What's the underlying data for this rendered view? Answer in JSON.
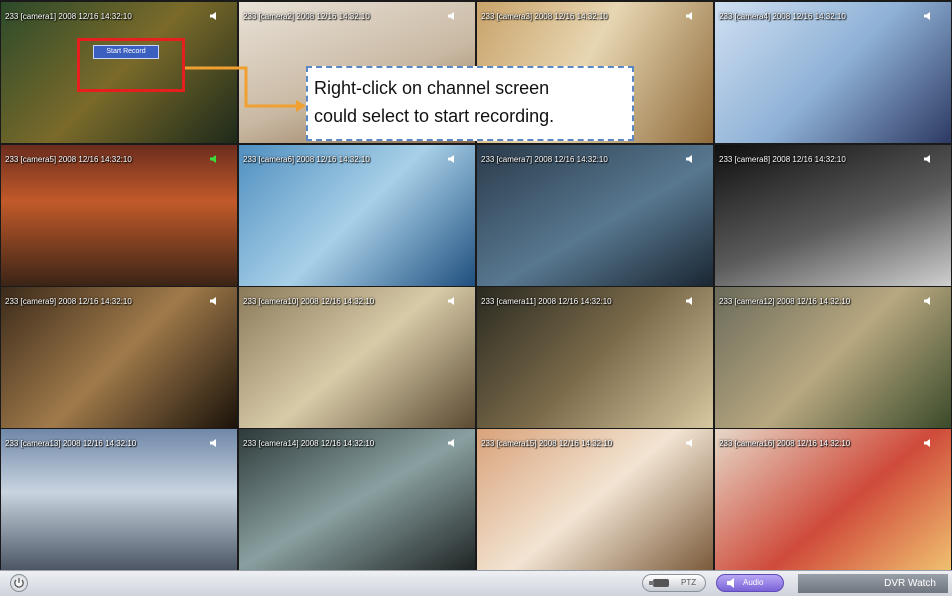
{
  "channels": [
    {
      "label": "233 [camera1] 2008 12/16 14:32:10"
    },
    {
      "label": "233 [camera2] 2008 12/16 14:32:10"
    },
    {
      "label": "233 [camera3] 2008 12/16 14:32:10"
    },
    {
      "label": "233 [camera4] 2008 12/16 14:32:10"
    },
    {
      "label": "233 [camera5] 2008 12/16 14:32:10"
    },
    {
      "label": "233 [camera6] 2008 12/16 14:32:10"
    },
    {
      "label": "233 [camera7] 2008 12/16 14:32:10"
    },
    {
      "label": "233 [camera8] 2008 12/16 14:32:10"
    },
    {
      "label": "233 [camera9] 2008 12/16 14:32:10"
    },
    {
      "label": "233 [camera10] 2008 12/16 14:32:10"
    },
    {
      "label": "233 [camera11] 2008 12/16 14:32:10"
    },
    {
      "label": "233 [camera12] 2008 12/16 14:32:10"
    },
    {
      "label": "233 [camera13] 2008 12/16 14:32:10"
    },
    {
      "label": "233 [camera14] 2008 12/16 14:32:10"
    },
    {
      "label": "233 [camera15] 2008 12/16 14:32:10"
    },
    {
      "label": "233 [camera16] 2008 12/16 14:32:10"
    }
  ],
  "context_menu": {
    "item": "Start Record"
  },
  "callout": {
    "line1": "Right-click on channel screen",
    "line2": "could select to start recording."
  },
  "bottombar": {
    "ptz_label": "PTZ",
    "audio_label": "Audio",
    "mode_label": "DVR Watch"
  },
  "colors": {
    "highlight_box": "#e61e1e",
    "callout_border": "#5a86c4",
    "arrow": "#f0a030",
    "audio_button": "#7a64d8"
  },
  "icons": [
    "speaker-icon",
    "power-icon",
    "ptz-camera-icon",
    "audio-icon"
  ]
}
